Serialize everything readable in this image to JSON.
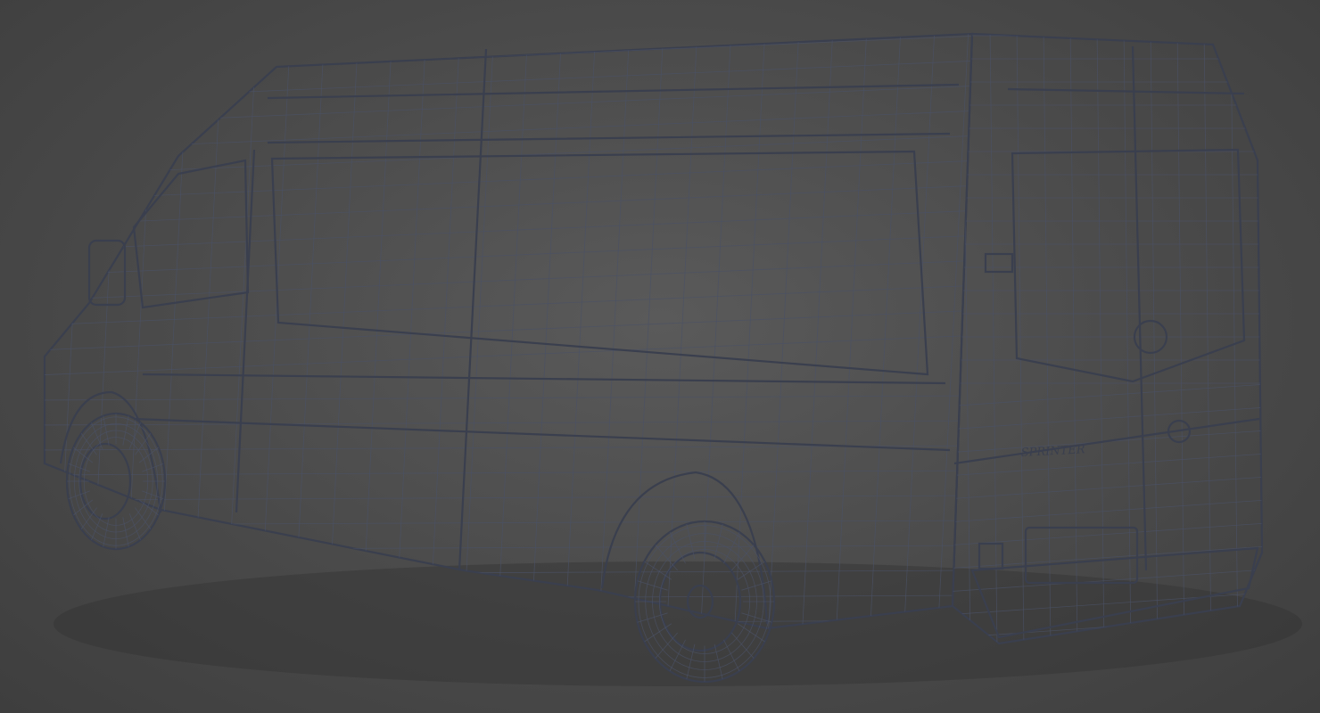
{
  "scene": {
    "subject": "van-wireframe-render",
    "badge_text": "SPRINTER",
    "colors": {
      "background": "#4a4a4a",
      "body": "#b9c1d9",
      "wire": "#4b5266"
    }
  }
}
